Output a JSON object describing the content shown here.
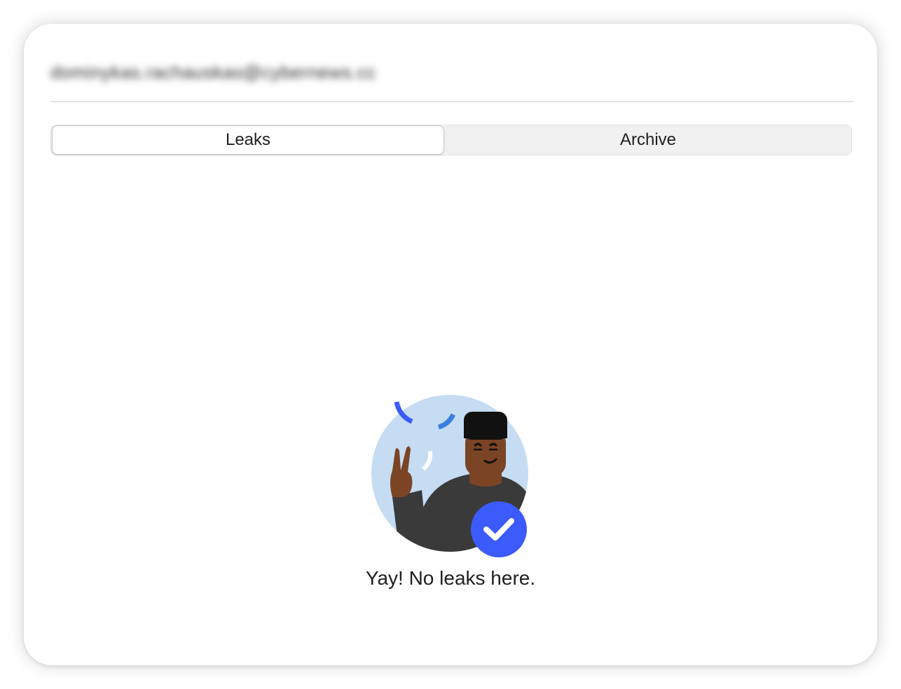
{
  "account": {
    "email": "dominykas.rachauskas@cybernews.cc"
  },
  "tabs": {
    "leaks_label": "Leaks",
    "archive_label": "Archive",
    "selected": "Leaks"
  },
  "empty_state": {
    "message": "Yay! No leaks here."
  },
  "colors": {
    "accent": "#3b5bfd",
    "illustration_bg": "#c5dcf3",
    "sweater": "#3a3a3a",
    "skin": "#7b4425"
  }
}
